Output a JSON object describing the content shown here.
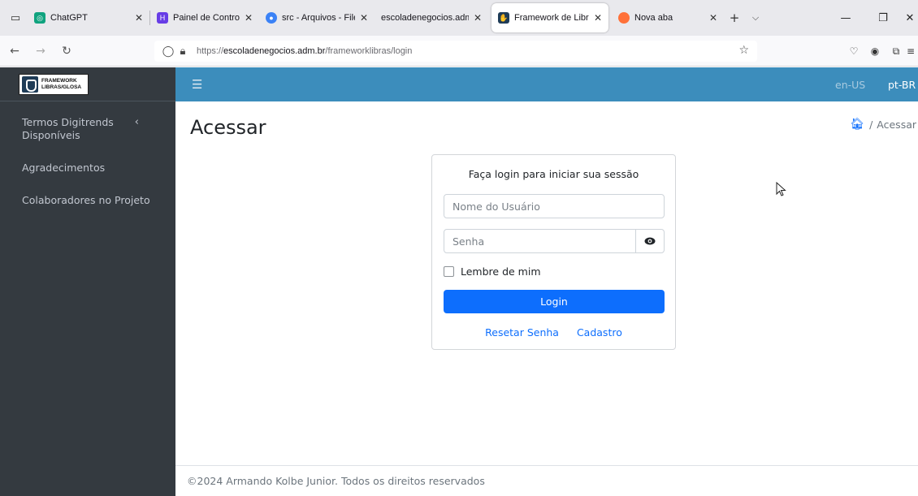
{
  "browser": {
    "tabs": [
      {
        "title": "ChatGPT",
        "close": "✕",
        "favicon_color": "#10a37f",
        "active": false
      },
      {
        "title": "Painel de Controle | H",
        "close": "✕",
        "favicon_color": "#673de6",
        "active": false
      },
      {
        "title": "src - Arquivos - File Br",
        "close": "✕",
        "favicon_color": "#3b82f6",
        "active": false
      },
      {
        "title": "escoladenegocios.adm.br/",
        "close": "✕",
        "favicon_color": "",
        "active": false
      },
      {
        "title": "Framework de Libras/C",
        "close": "✕",
        "favicon_color": "#1f3c57",
        "active": true
      },
      {
        "title": "Nova aba",
        "close": "✕",
        "favicon_color": "#ff7139",
        "active": false
      }
    ],
    "new_tab": "+",
    "url_prefix": "https://",
    "url_host": "escoladenegocios.adm.br",
    "url_path": "/frameworklibras/login"
  },
  "sidebar": {
    "logo_text_1": "FRAMEWORK",
    "logo_text_2": "LIBRAS/GLOSA",
    "items": [
      {
        "label": "Termos Digitrends Disponíveis",
        "has_chevron": true
      },
      {
        "label": "Agradecimentos"
      },
      {
        "label": "Colaboradores no Projeto"
      }
    ]
  },
  "topbar": {
    "lang_en": "en-US",
    "lang_pt": "pt-BR"
  },
  "page": {
    "title": "Acessar",
    "breadcrumb_current": "Acessar"
  },
  "login": {
    "message": "Faça login para iniciar sua sessão",
    "username_placeholder": "Nome do Usuário",
    "password_placeholder": "Senha",
    "remember_label": "Lembre de mim",
    "button_label": "Login",
    "reset_link": "Resetar Senha",
    "register_link": "Cadastro"
  },
  "footer": {
    "text": "©2024 Armando Kolbe Junior. Todos os direitos reservados"
  },
  "colors": {
    "sidebar_bg": "#343a40",
    "topbar_bg": "#3c8dbc",
    "primary": "#0d6efd"
  }
}
